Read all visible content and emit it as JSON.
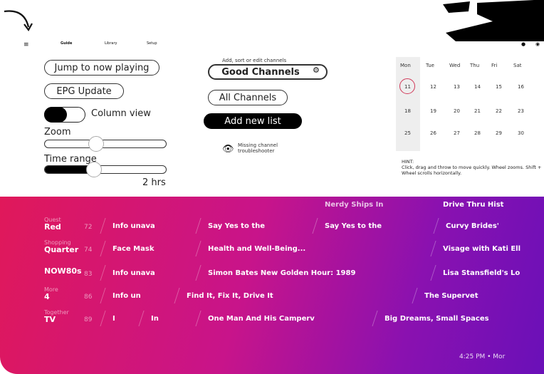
{
  "nav": {
    "menu_icon": "≡",
    "items": [
      "Guide",
      "Library",
      "Setup"
    ]
  },
  "buttons": {
    "jump": "Jump to now playing",
    "epg_update": "EPG Update",
    "column_view": "Column view",
    "add_new_list": "Add new list",
    "missing_channel": "Missing channel troubleshooter"
  },
  "controls": {
    "zoom_label": "Zoom",
    "zoom_level": 0.42,
    "time_range_label": "Time range",
    "time_range_value": "2 hrs",
    "time_range_level": 0.4
  },
  "channels_panel": {
    "caption": "Add, sort or edit channels",
    "lists": [
      "Good Channels",
      "All Channels"
    ],
    "selected": "Good Channels"
  },
  "calendar": {
    "weekdays": [
      "Mon",
      "Tue",
      "Wed",
      "Thu",
      "Fri",
      "Sat"
    ],
    "weeks": [
      [
        "11",
        "12",
        "13",
        "14",
        "15",
        "16"
      ],
      [
        "18",
        "19",
        "20",
        "21",
        "22",
        "23"
      ],
      [
        "25",
        "26",
        "27",
        "28",
        "29",
        "30"
      ]
    ],
    "today": "11",
    "hint_title": "HINT:",
    "hint_text": "Click, drag and throw to move quickly. Wheel zooms. Shift + Wheel scrolls horizontally."
  },
  "guide": {
    "top_row": [
      "Nerdy Ships In",
      "Drive Thru Hist"
    ],
    "rows": [
      {
        "channel": "Red",
        "sub": "Quest",
        "number": "72",
        "programs": [
          "Info unava",
          "Say Yes to the",
          "Say Yes to the",
          "Curvy Brides'"
        ]
      },
      {
        "channel": "Quarter",
        "sub": "Shopping",
        "number": "74",
        "programs": [
          "Face Mask",
          "Health and Well-Being...",
          "Visage with Kati Ell"
        ]
      },
      {
        "channel": "NOW80s",
        "sub": "",
        "number": "83",
        "programs": [
          "Info unava",
          "Simon Bates New Golden Hour: 1989",
          "Lisa Stansfield's Lo"
        ]
      },
      {
        "channel": "4",
        "sub": "More",
        "number": "86",
        "programs": [
          "Info un",
          "Find It, Fix It, Drive It",
          "The Supervet"
        ]
      },
      {
        "channel": "TV",
        "sub": "Together",
        "number": "89",
        "programs": [
          "I",
          "In",
          "One Man And His Camperv",
          "Big Dreams, Small Spaces"
        ]
      }
    ],
    "clock": "4:25 PM • Mor"
  },
  "colors": {
    "accent": "#e0185a",
    "gradient_end": "#6a10b8",
    "today_ring": "#d13a5a"
  }
}
